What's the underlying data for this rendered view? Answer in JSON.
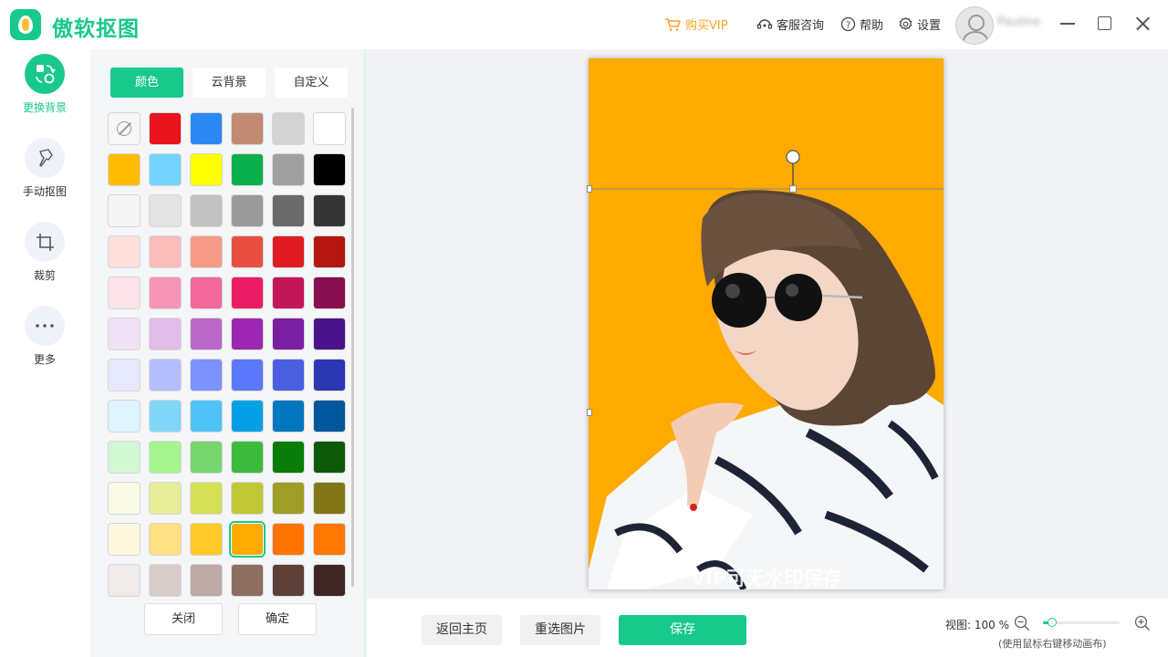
{
  "app": {
    "name": "傲软抠图"
  },
  "header": {
    "buy_vip": "购买VIP",
    "support": "客服咨询",
    "help": "帮助",
    "settings": "设置",
    "username": "Pauline"
  },
  "nav": {
    "items": [
      {
        "label": "更换背景",
        "icon": "swap-background-icon"
      },
      {
        "label": "手动抠图",
        "icon": "pin-brush-icon"
      },
      {
        "label": "裁剪",
        "icon": "crop-icon"
      },
      {
        "label": "更多",
        "icon": "more-dots-icon"
      }
    ]
  },
  "panel": {
    "tabs": [
      "颜色",
      "云背景",
      "自定义"
    ],
    "active_tab": 0,
    "swatches": [
      [
        "none",
        "#e8141e",
        "#2b88f5",
        "#c08a73",
        "#d3d3d3",
        "#ffffff"
      ],
      [
        "#ffbb00",
        "#73d4ff",
        "#ffff00",
        "#0ab04c",
        "#a0a0a0",
        "#000000"
      ],
      [
        "#f5f5f5",
        "#e3e3e3",
        "#c2c2c2",
        "#9a9a9a",
        "#6a6a6a",
        "#353535"
      ],
      [
        "#fde0dc",
        "#f9bcbb",
        "#f69a87",
        "#e84f40",
        "#e01c22",
        "#b3170f"
      ],
      [
        "#fbe3ea",
        "#f596b6",
        "#f2689a",
        "#ec1c64",
        "#c2185a",
        "#880e4f"
      ],
      [
        "#f1e1f5",
        "#e0bde7",
        "#ba68c8",
        "#9c27b0",
        "#7b1fa2",
        "#4a148c"
      ],
      [
        "#e6e9fd",
        "#b3bdfe",
        "#7b92ff",
        "#5c78ff",
        "#4a5fe0",
        "#2c37b3"
      ],
      [
        "#e0f4fd",
        "#80d6f9",
        "#4fc3f7",
        "#03a0e6",
        "#0277bd",
        "#01579b"
      ],
      [
        "#d2f7d4",
        "#a5f48d",
        "#77d570",
        "#3cba3c",
        "#0a7c0a",
        "#0d5a0b"
      ],
      [
        "#f9fbe7",
        "#e6ec98",
        "#d4e157",
        "#c0c736",
        "#9e9e28",
        "#827717"
      ],
      [
        "#fff8e1",
        "#ffe082",
        "#ffca28",
        "#ffaa00",
        "#ff7300",
        "#ff7600"
      ],
      [
        "#efebe9",
        "#d7ccc8",
        "#bcaaa4",
        "#8d6e63",
        "#5d4037",
        "#3e2723"
      ]
    ],
    "selected_swatch": [
      10,
      3
    ],
    "close_label": "关闭",
    "confirm_label": "确定"
  },
  "canvas": {
    "background_color": "#ffaa00",
    "watermark": "VIP可无水印保存"
  },
  "bottom": {
    "home_label": "返回主页",
    "reselect_label": "重选图片",
    "save_label": "保存",
    "zoom_label": "视图: 100 %",
    "zoom_value": 100,
    "zoom_hint": "(使用鼠标右键移动画布)"
  }
}
